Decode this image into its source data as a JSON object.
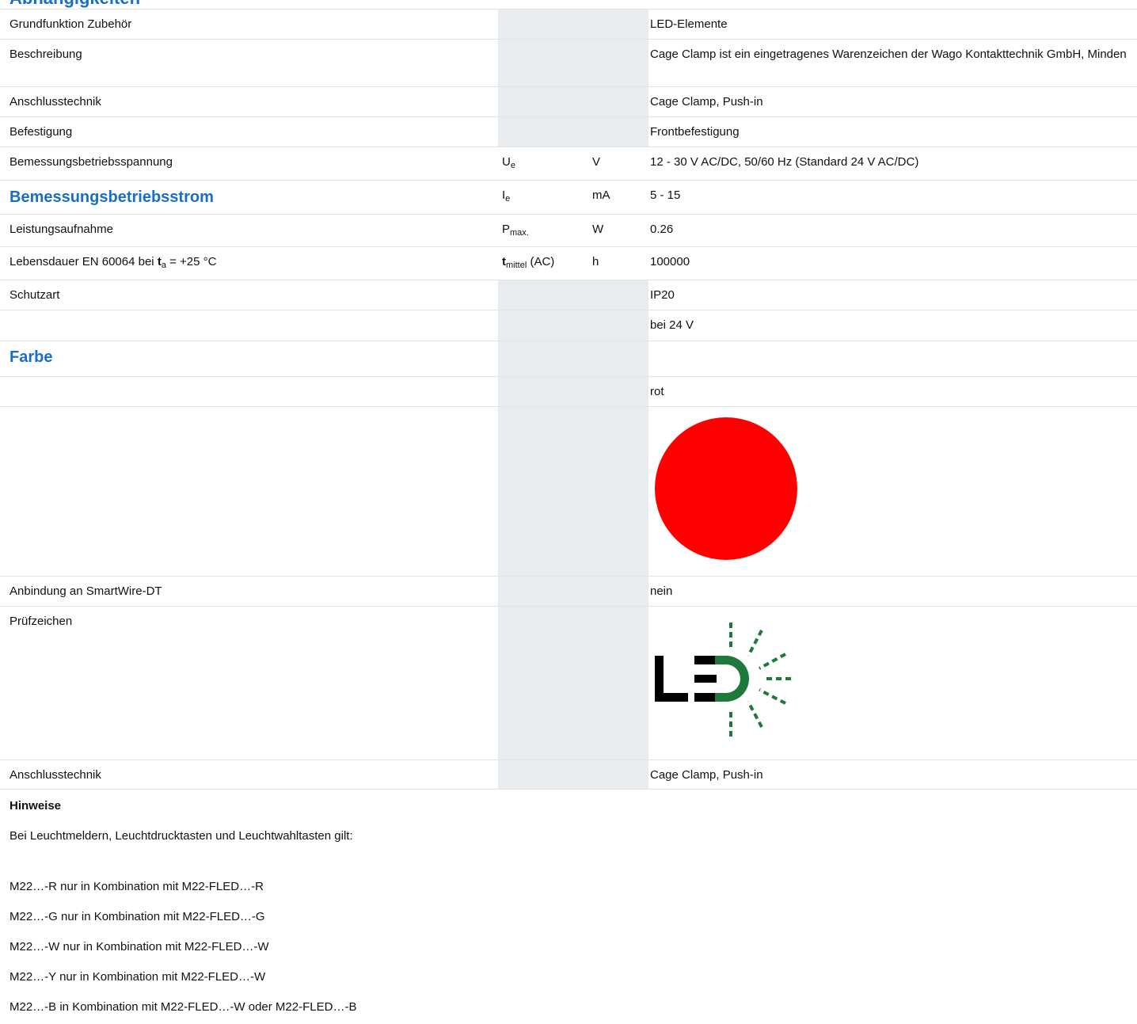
{
  "top_heading": "Abhängigkeiten",
  "rows": [
    {
      "label": "Grundfunktion Zubehör",
      "value": "LED-Elemente"
    },
    {
      "label": "Beschreibung",
      "value": "Cage Clamp ist ein eingetragenes Warenzeichen der Wago Kontakttechnik GmbH, Minden"
    },
    {
      "label": "Anschlusstechnik",
      "value": "Cage Clamp, Push-in"
    },
    {
      "label": "Befestigung",
      "value": "Frontbefestigung"
    },
    {
      "label": "Bemessungsbetriebsspannung",
      "sym": "U",
      "sym_sub": "e",
      "unit": "V",
      "value": "12 - 30 V AC/DC, 50/60 Hz (Standard 24 V AC/DC)"
    },
    {
      "label": "Bemessungsbetriebsstrom",
      "sym": "I",
      "sym_sub": "e",
      "unit": "mA",
      "value": "5 - 15"
    },
    {
      "label": "Leistungsaufnahme",
      "sym": "P",
      "sym_sub": "max.",
      "unit": "W",
      "value": "0.26"
    },
    {
      "label_pre": "Lebensdauer EN 60064 bei ",
      "label_bold": "t",
      "label_sub": "a",
      "label_post": " = +25 °C",
      "sym_bold": "t",
      "sym_sub": "mittel",
      "sym_post": " (AC)",
      "unit": "h",
      "value": "100000"
    },
    {
      "label": "Schutzart",
      "value": "IP20"
    },
    {
      "label": "",
      "value": "bei 24 V"
    },
    {
      "label": "Farbe",
      "value": ""
    },
    {
      "label": "",
      "value": "rot"
    },
    {
      "label": "Anbindung an SmartWire-DT",
      "value": "nein"
    },
    {
      "label": "Prüfzeichen",
      "logo_text": "LED"
    },
    {
      "label": "Anschlusstechnik",
      "value": "Cage Clamp, Push-in"
    }
  ],
  "colors": {
    "accent": "#1a6fc2",
    "color_swatch": "#ff0000",
    "logo_black": "#000000",
    "logo_green": "#1e7a3a",
    "shade": "#e9ecee"
  },
  "notes": {
    "heading": "Hinweise",
    "intro": "Bei Leuchtmeldern, Leuchtdrucktasten und Leuchtwahltasten gilt:",
    "items": [
      "M22…-R nur in Kombination mit M22-FLED…-R",
      "M22…-G nur in Kombination mit M22-FLED…-G",
      "M22…-W nur in Kombination mit M22-FLED…-W",
      "M22…-Y nur in Kombination mit M22-FLED…-W",
      "M22…-B in Kombination mit M22-FLED…-W oder M22-FLED…-B"
    ]
  }
}
